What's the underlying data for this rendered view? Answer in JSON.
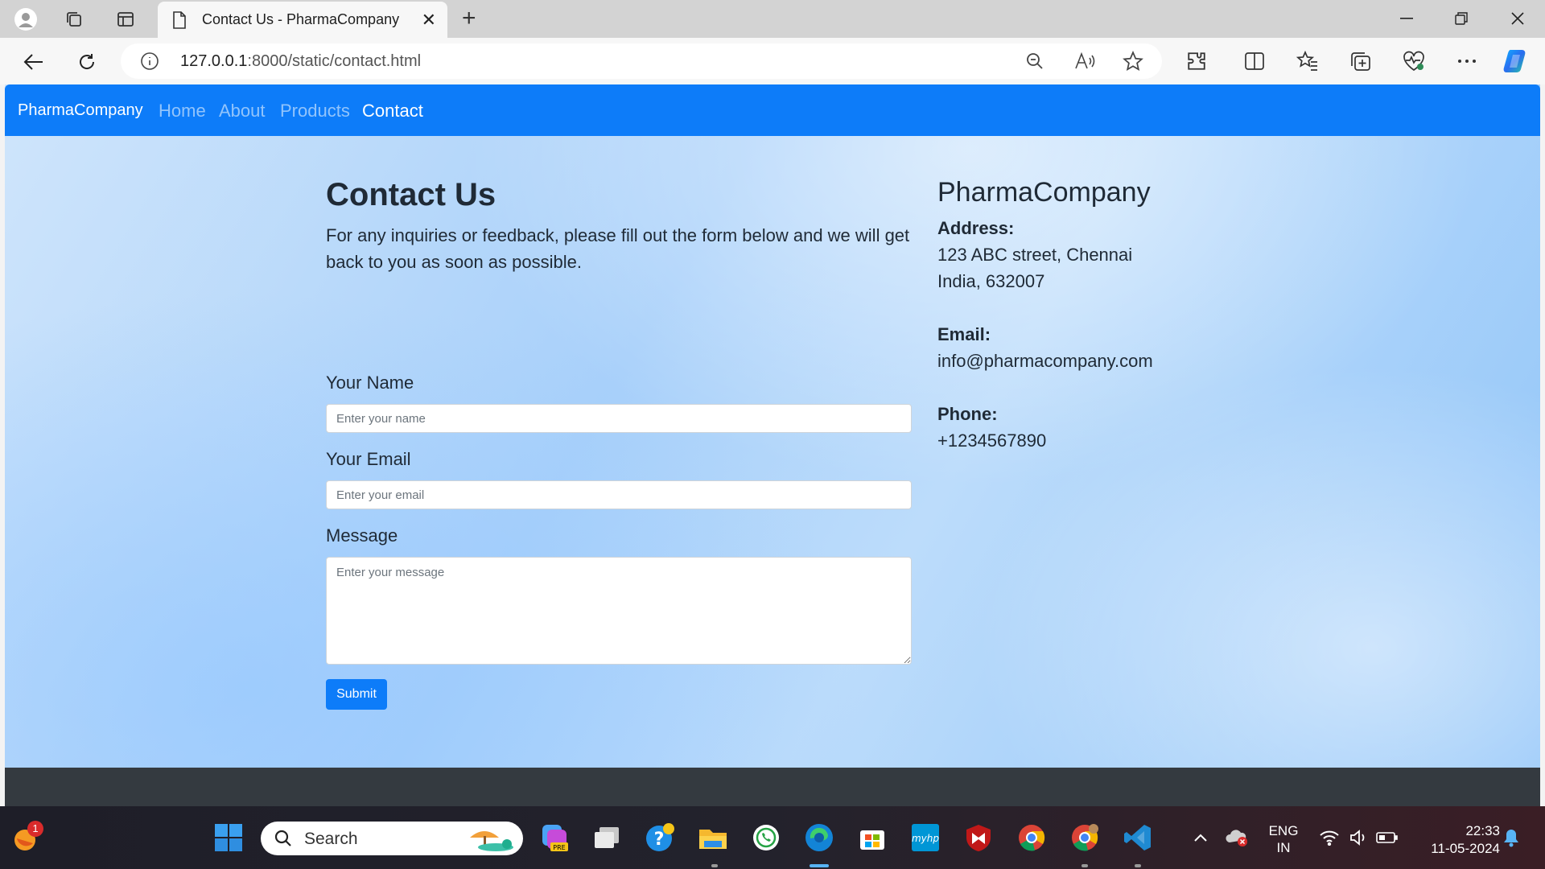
{
  "browser": {
    "tab_title": "Contact Us - PharmaCompany",
    "url_host": "127.0.0.1",
    "url_rest": ":8000/static/contact.html"
  },
  "nav": {
    "brand": "PharmaCompany",
    "links": [
      "Home",
      "About",
      "Products",
      "Contact"
    ],
    "active": "Contact"
  },
  "contact": {
    "title": "Contact Us",
    "intro": "For any inquiries or feedback, please fill out the form below and we will get back to you as soon as possible.",
    "name_label": "Your Name",
    "name_placeholder": "Enter your name",
    "email_label": "Your Email",
    "email_placeholder": "Enter your email",
    "message_label": "Message",
    "message_placeholder": "Enter your message",
    "submit_label": "Submit"
  },
  "company": {
    "name": "PharmaCompany",
    "address_label": "Address:",
    "address_line1": "123 ABC street, Chennai",
    "address_line2": "India, 632007",
    "email_label": "Email:",
    "email": "info@pharmacompany.com",
    "phone_label": "Phone:",
    "phone": "+1234567890"
  },
  "taskbar": {
    "search_label": "Search",
    "notification_count": "1",
    "lang_line1": "ENG",
    "lang_line2": "IN",
    "time": "22:33",
    "date": "11-05-2024"
  },
  "colors": {
    "navbar": "#0d7cf9",
    "submit": "#0d7cf9",
    "footer": "#343a40"
  }
}
